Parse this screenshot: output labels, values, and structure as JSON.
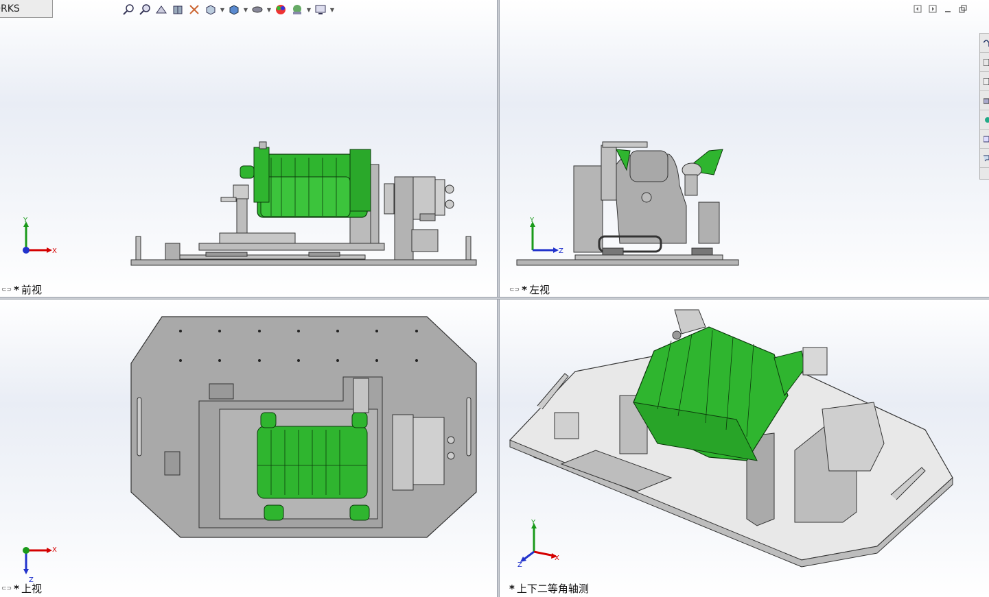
{
  "tab": {
    "label": "ORKS MBD"
  },
  "toolbar": {
    "icons": [
      "zoom-to-fit-icon",
      "zoom-to-area-icon",
      "previous-view-icon",
      "section-view-icon",
      "dynamic-annotation-icon",
      "view-orientation-icon",
      "display-style-icon",
      "hide-show-icon",
      "edit-appearance-icon",
      "apply-scene-icon",
      "view-settings-icon"
    ]
  },
  "viewports": {
    "front": {
      "label": "前视"
    },
    "left": {
      "label": "左视"
    },
    "top": {
      "label": "上视"
    },
    "iso": {
      "label": "上下二等角轴测"
    }
  },
  "triads": {
    "front": {
      "a": "Y",
      "b": "X"
    },
    "left": {
      "a": "Y",
      "b": "Z"
    },
    "top": {
      "a": "X",
      "b": "Z"
    },
    "iso": {
      "a": "Y",
      "b": "X",
      "c": "Z"
    }
  },
  "colors": {
    "green": "#2fb52f",
    "gray": "#a9a9a9",
    "dark": "#3a3a3a",
    "axisRed": "#d40000",
    "axisGreen": "#1a9a1a",
    "axisBlue": "#2233cc"
  }
}
